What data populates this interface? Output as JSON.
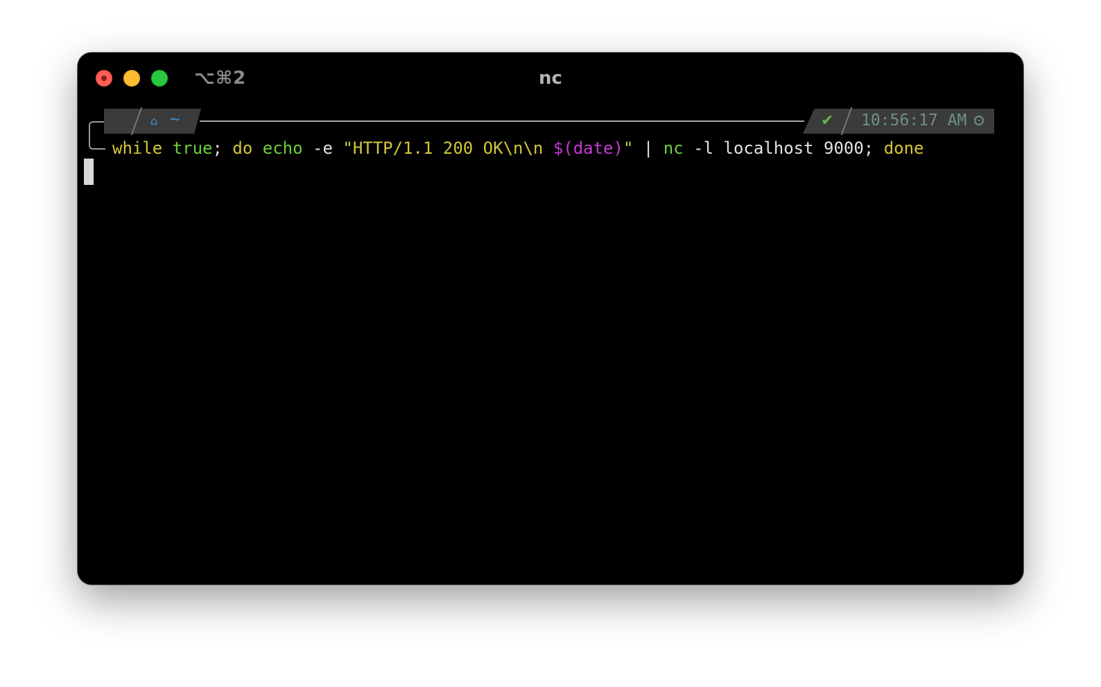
{
  "window": {
    "shortcut": "⌥⌘2",
    "title": "nc"
  },
  "prompt": {
    "os_icon": "apple-icon",
    "home_icon": "home-icon",
    "path": "~",
    "status_icon": "check-icon",
    "time": "10:56:17 AM",
    "time_icon": "clock-icon"
  },
  "command": {
    "tokens": {
      "while": "while",
      "true": "true",
      "semi1": ";",
      "do": "do",
      "echo": "echo",
      "flag_e": "-e",
      "str_open": "\"HTTP/1.1 200 OK\\n\\n ",
      "subshell": "$(date)",
      "str_close": "\"",
      "pipe": "|",
      "nc": "nc",
      "flag_l": "-l",
      "host": "localhost",
      "port": "9000",
      "semi2": ";",
      "done": "done"
    }
  },
  "colors": {
    "keyword": "#d3c73a",
    "builtin": "#6fcf3a",
    "subshell": "#c43ad3",
    "path": "#3a8fd6",
    "time": "#6d9089"
  }
}
